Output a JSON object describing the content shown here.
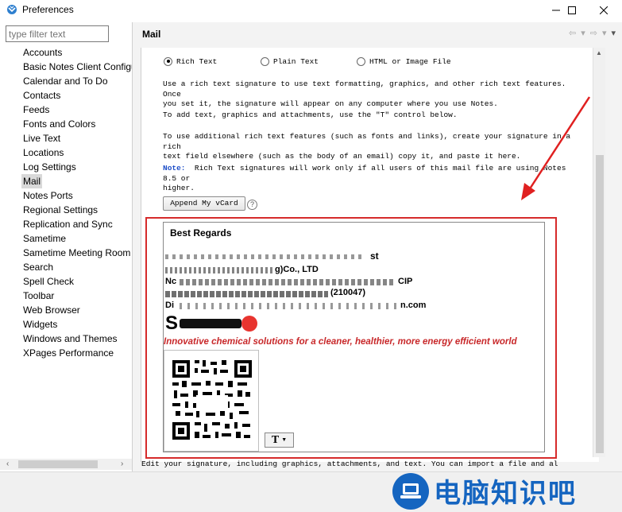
{
  "window": {
    "title": "Preferences"
  },
  "filter": {
    "placeholder": "type filter text"
  },
  "nav": {
    "items": [
      {
        "label": "Accounts"
      },
      {
        "label": "Basic Notes Client Configu"
      },
      {
        "label": "Calendar and To Do"
      },
      {
        "label": "Contacts"
      },
      {
        "label": "Feeds"
      },
      {
        "label": "Fonts and Colors"
      },
      {
        "label": "Live Text"
      },
      {
        "label": "Locations"
      },
      {
        "label": "Log Settings"
      },
      {
        "label": "Mail",
        "selected": true
      },
      {
        "label": "Notes Ports"
      },
      {
        "label": "Regional Settings"
      },
      {
        "label": "Replication and Sync"
      },
      {
        "label": "Sametime"
      },
      {
        "label": "Sametime Meeting Room"
      },
      {
        "label": "Search"
      },
      {
        "label": "Spell Check"
      },
      {
        "label": "Toolbar"
      },
      {
        "label": "Web Browser"
      },
      {
        "label": "Widgets"
      },
      {
        "label": "Windows and Themes"
      },
      {
        "label": "XPages Performance"
      }
    ]
  },
  "page": {
    "title": "Mail"
  },
  "signature": {
    "options": [
      {
        "label": "Rich Text",
        "selected": true
      },
      {
        "label": "Plain Text",
        "selected": false
      },
      {
        "label": "HTML or Image File",
        "selected": false
      }
    ],
    "para1": "Use a rich text signature to use text formatting, graphics, and other rich text features.  Once\nyou set it, the signature will appear on any computer where you use Notes.",
    "para2": "To add text, graphics and attachments, use the \"T\" control below.",
    "para3": "To use additional rich text features (such as fonts and links), create your signature in a rich\ntext field elsewhere (such as the body of an email) copy it, and paste it here.",
    "note_label": "Note:",
    "note_text": "  Rich Text signatures will work only if all users of this mail file are using Notes 8.5 or\nhigher.",
    "vcard_button": "Append My vCard",
    "help_icon": "?",
    "body": {
      "greeting": "Best Regards",
      "line2": "st",
      "line3_end": "g)Co., LTD",
      "line4_start": "Nc",
      "line4_end": "CIP",
      "line5_mid": "(210047)",
      "line6_start": "Di",
      "line6_end": "n.com",
      "logo": "S",
      "tagline": "Innovative chemical solutions for a cleaner, healthier, more energy efficient world"
    },
    "t_control": "T",
    "bottom_hint": "Edit your signature, including graphics, attachments, and text.  You can import a file and al"
  },
  "watermark": {
    "text": "电脑知识吧"
  },
  "colors": {
    "highlight": "#d62b2b",
    "tagline": "#c8282a",
    "note": "#1f4fc8"
  }
}
